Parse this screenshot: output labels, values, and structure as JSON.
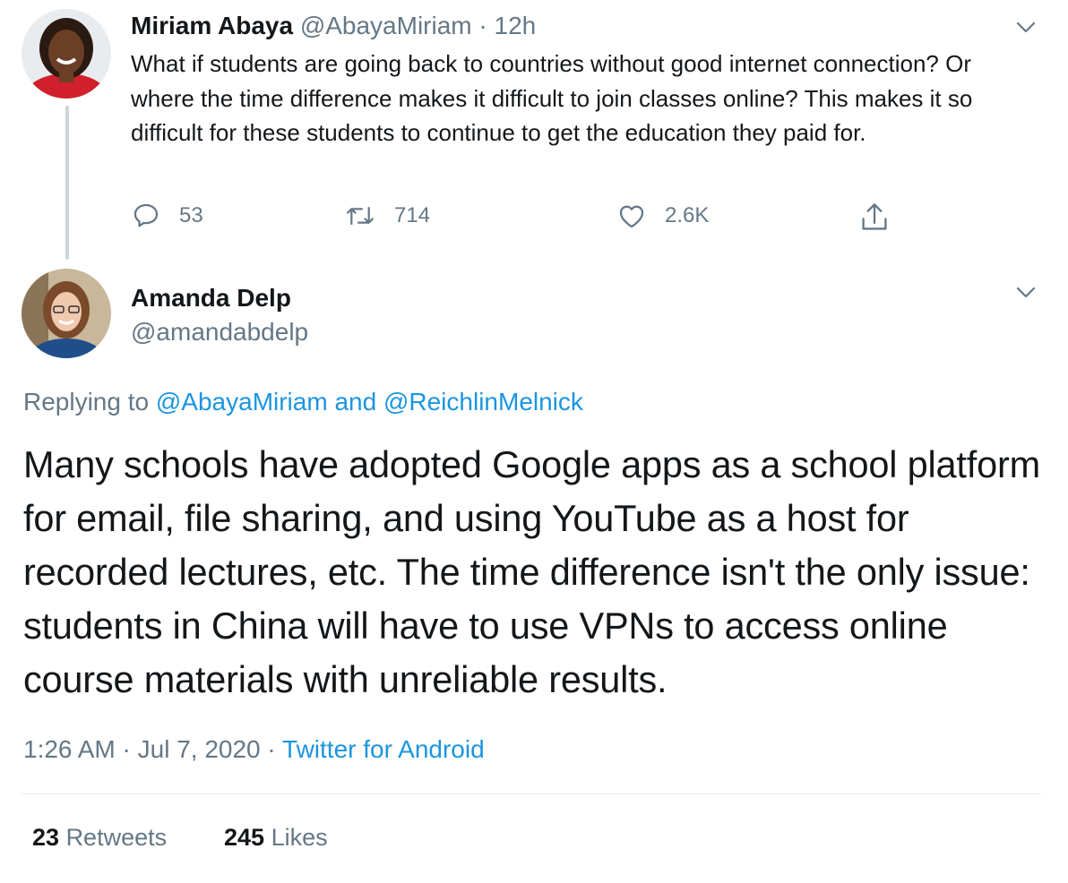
{
  "parent_tweet": {
    "author_name": "Miriam Abaya",
    "author_handle": "@AbayaMiriam",
    "separator": "·",
    "time": "12h",
    "text": "What if students are going back to countries without good internet connection? Or where the time difference makes it difficult to join classes online? This makes it so difficult for these students to continue to get the education they paid for.",
    "reply_count": "53",
    "retweet_count": "714",
    "like_count": "2.6K",
    "icons": [
      "reply-icon",
      "retweet-icon",
      "like-icon",
      "share-icon",
      "chevron-down-icon"
    ]
  },
  "main_tweet": {
    "author_name": "Amanda Delp",
    "author_handle": "@amandabdelp",
    "replying_prefix": "Replying to",
    "reply_target_1": "@AbayaMiriam",
    "reply_and": "and",
    "reply_target_2": "@ReichlinMelnick",
    "text": "Many schools have adopted Google apps as a school platform for email, file sharing, and using YouTube as a host for recorded lectures, etc. The time difference isn't the only issue: students in China will have to use VPNs to access online course materials with unreliable results.",
    "time": "1:26 AM",
    "date": "Jul 7, 2020",
    "dot": "·",
    "source": "Twitter for Android",
    "retweets_count": "23",
    "retweets_label": "Retweets",
    "likes_count": "245",
    "likes_label": "Likes"
  },
  "colors": {
    "text": "#14171a",
    "muted": "#657786",
    "link": "#1b95e0",
    "thread_line": "#ccd6dd",
    "divider": "#e6ecf0"
  }
}
